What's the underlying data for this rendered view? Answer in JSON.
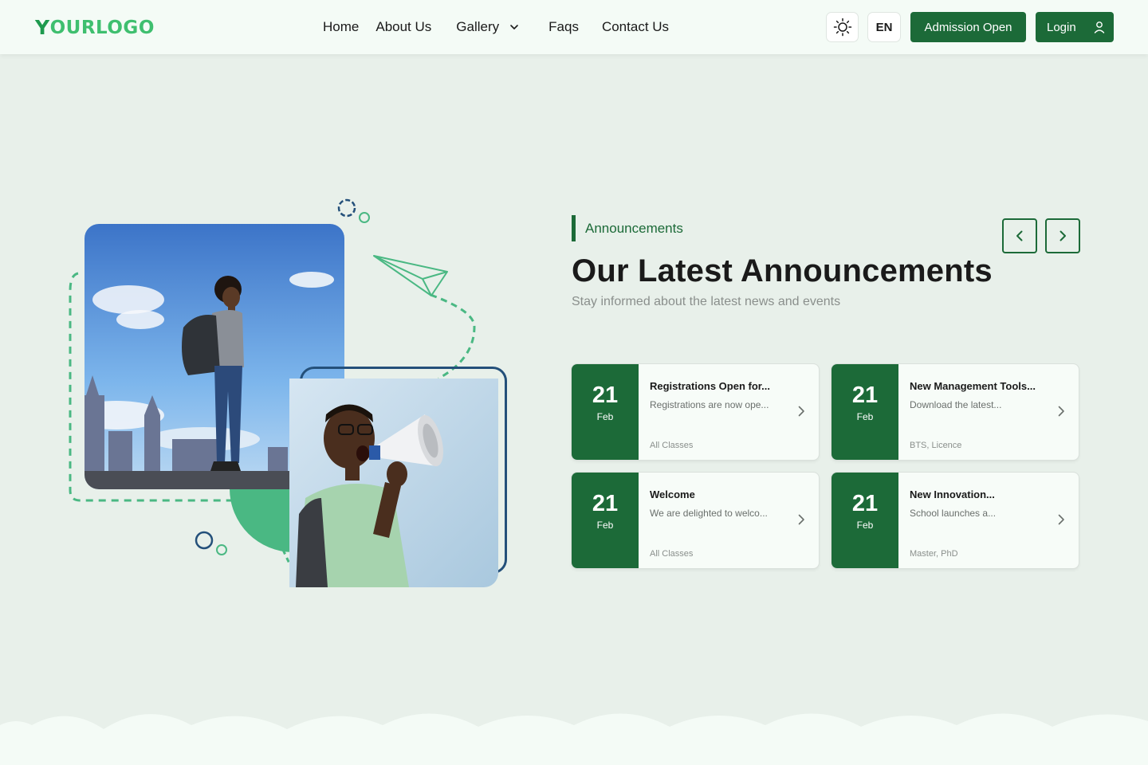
{
  "logo": {
    "first_letter": "Y",
    "rest": "OURLOGO"
  },
  "nav": {
    "home": "Home",
    "about": "About Us",
    "gallery": "Gallery",
    "faqs": "Faqs",
    "contact": "Contact Us"
  },
  "header": {
    "lang": "EN",
    "admission": "Admission Open",
    "login": "Login"
  },
  "announcements": {
    "tag": "Announcements",
    "title": "Our Latest Announcements",
    "subtitle": "Stay informed about the latest news and events",
    "cards": [
      {
        "day": "21",
        "month": "Feb",
        "title": "Registrations Open for...",
        "desc": "Registrations are now ope...",
        "category": "All Classes"
      },
      {
        "day": "21",
        "month": "Feb",
        "title": "New Management Tools...",
        "desc": "Download the latest...",
        "category": "BTS, Licence"
      },
      {
        "day": "21",
        "month": "Feb",
        "title": "Welcome",
        "desc": "We are delighted to welco...",
        "category": "All Classes"
      },
      {
        "day": "21",
        "month": "Feb",
        "title": "New Innovation...",
        "desc": "School launches a...",
        "category": "Master, PhD"
      }
    ]
  },
  "colors": {
    "brand": "#1c6a38",
    "logo_green": "#3fbf6f",
    "accent_green": "#4ab883",
    "page_bg": "#e8f0ea",
    "frame_blue": "#24507a"
  }
}
